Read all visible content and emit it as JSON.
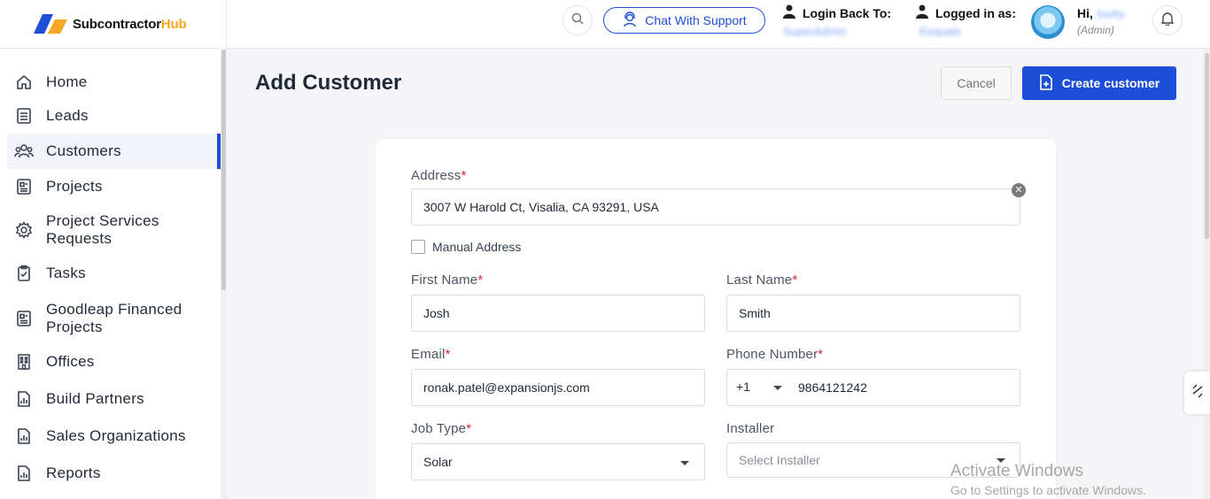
{
  "brand": {
    "name": "Subcontractor",
    "name_accent": "Hub"
  },
  "sidebar": {
    "items": [
      {
        "label": "Home",
        "icon": "home-icon"
      },
      {
        "label": "Leads",
        "icon": "leads-icon"
      },
      {
        "label": "Customers",
        "icon": "customers-icon",
        "active": true
      },
      {
        "label": "Projects",
        "icon": "projects-icon"
      },
      {
        "label": "Project Services Requests",
        "icon": "gear-icon"
      },
      {
        "label": "Tasks",
        "icon": "clipboard-icon"
      },
      {
        "label": "Goodleap Financed Projects",
        "icon": "projects-icon"
      },
      {
        "label": "Offices",
        "icon": "building-icon"
      },
      {
        "label": "Build Partners",
        "icon": "report-icon"
      },
      {
        "label": "Sales Organizations",
        "icon": "report-icon"
      },
      {
        "label": "Reports",
        "icon": "report-icon"
      }
    ]
  },
  "header": {
    "chat_label": "Chat With Support",
    "login_back_label": "Login Back To:",
    "login_back_value": "SuperAdmin",
    "logged_in_label": "Logged in as:",
    "logged_in_value": "Eequals",
    "greeting": "Hi,",
    "user_name": "Swifty",
    "user_role": "(Admin)"
  },
  "page": {
    "title": "Add Customer",
    "cancel_label": "Cancel",
    "create_label": "Create customer"
  },
  "form": {
    "address_label": "Address",
    "address_value": "3007 W Harold Ct, Visalia, CA 93291, USA",
    "manual_address_label": "Manual Address",
    "first_name_label": "First Name",
    "first_name_value": "Josh",
    "last_name_label": "Last Name",
    "last_name_value": "Smith",
    "email_label": "Email",
    "email_value": "ronak.patel@expansionjs.com",
    "phone_label": "Phone Number",
    "phone_code": "+1",
    "phone_value": "9864121242",
    "job_type_label": "Job Type",
    "job_type_value": "Solar",
    "installer_label": "Installer",
    "installer_placeholder": "Select Installer",
    "required_mark": "*"
  },
  "watermark": {
    "line1": "Activate Windows",
    "line2": "Go to Settings to activate Windows."
  },
  "colors": {
    "accent": "#1d4ed8",
    "brand_orange": "#f5a623",
    "required": "#dc2626"
  }
}
